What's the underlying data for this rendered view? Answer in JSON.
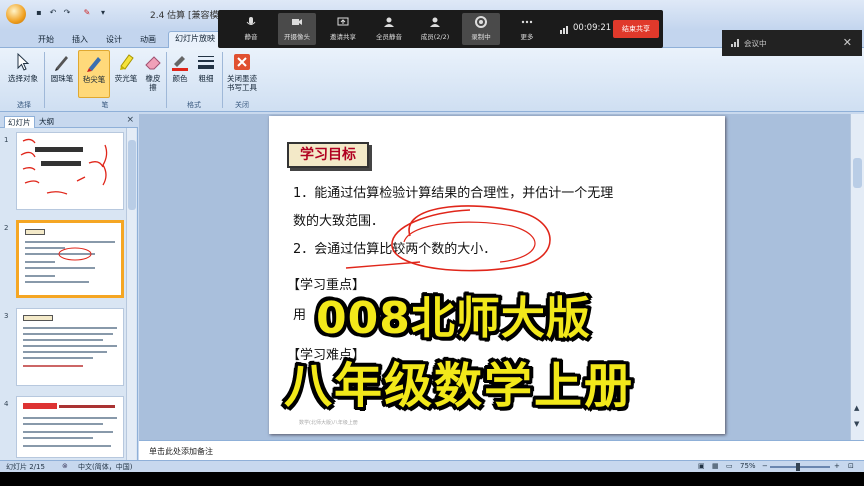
{
  "window": {
    "title": "2.4  估算 [兼容模式]"
  },
  "ribbon": {
    "tabs": [
      "开始",
      "插入",
      "设计",
      "动画",
      "幻灯片放映"
    ],
    "active_tab": "幻灯片放映",
    "buttons": {
      "select_objects": "选择对象",
      "ballpoint_pen": "圆珠笔",
      "felt_pen": "毡尖笔",
      "highlighter": "荧光笔",
      "eraser": "橡皮擦",
      "color": "颜色",
      "weight": "粗细",
      "close_ink_tools": "关闭墨迹书写工具"
    },
    "groups": {
      "select": "选择",
      "pens": "笔",
      "format": "格式",
      "close": "关闭"
    }
  },
  "meeting_toolbar": {
    "buttons": [
      {
        "label": "静音",
        "icon": "mic-icon"
      },
      {
        "label": "开摄像头",
        "icon": "camera-icon"
      },
      {
        "label": "邀请共享",
        "icon": "share-icon"
      },
      {
        "label": "全员静音",
        "icon": "mute-all-icon"
      },
      {
        "label": "成员(2/2)",
        "icon": "members-icon"
      },
      {
        "label": "录制中",
        "icon": "record-icon"
      },
      {
        "label": "更多",
        "icon": "more-icon"
      }
    ],
    "timer": "00:09:21",
    "end_share_label": "结束共享",
    "panel_label": "会议中",
    "panel_close": "✕"
  },
  "slides_panel": {
    "tabs": [
      "幻灯片",
      "大纲"
    ],
    "close": "×",
    "slide_numbers": [
      "1",
      "2",
      "3",
      "4"
    ]
  },
  "slide": {
    "heading": "学习目标",
    "line1": "1．能通过估算检验计算结果的合理性，并估计一个无理",
    "line2": "数的大致范围．",
    "line3": "2．会通过估算比较两个数的大小．",
    "focus": "【学习重点】",
    "focus_text": "用",
    "difficulty": "【学习难点】",
    "footer": "数学(北师大版)八年级上册"
  },
  "notes_placeholder": "单击此处添加备注",
  "status": {
    "slide_count": "幻灯片 2/15",
    "language": "中文(简体，中国)",
    "zoom": "75%"
  },
  "overlay": {
    "line1": "008北师大版",
    "line2": "八年级数学上册"
  },
  "colors": {
    "overlay_text": "#f2e81a",
    "annotation_ink": "#e0261a",
    "heading_text": "#b00020",
    "end_share": "#e0392b"
  }
}
